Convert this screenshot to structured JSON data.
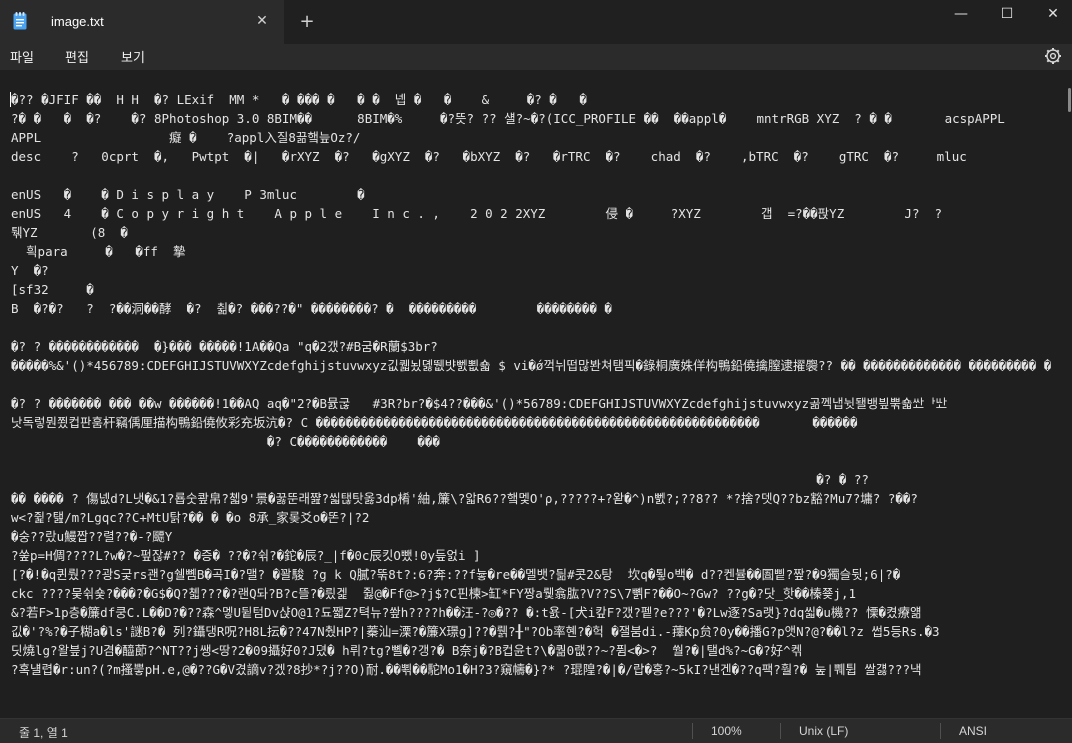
{
  "tab": {
    "title": "image.txt",
    "close_glyph": "✕",
    "new_tab_glyph": "+"
  },
  "window_controls": {
    "minimize": "—",
    "maximize": "☐",
    "close": "✕"
  },
  "menu": {
    "file": "파일",
    "edit": "편집",
    "view": "보기",
    "settings_icon": "gear-icon"
  },
  "editor": {
    "lines": [
      "�?? �JFIF ��  H H  �? LExif  MM *   � ��� �   � �  넵 �   �    &     �? �   �",
      "?� �   �  �?    �? 8Photoshop 3.0 8BIM��      8BIM�%     �?뜻? ?? 섈?~�?(ICC_PROFILE ��  ��appl�    mntrRGB XYZ  ? � �       acspAPPL",
      "APPL                 癡 �    ?appl入질8끎햌늪Oz?/",
      "desc    ?   0cprt  �,   Pwtpt  �|   �rXYZ  �?   �gXYZ  �?   �bXYZ  �?   �rTRC  �?    chad  �?    ,bTRC  �?    gTRC  �?     mluc",
      "",
      "enUS   �    � D i s p l a y    P 3mluc        �",
      "enUS   4    � C o p y r i g h t    A p p l e    I n c . ,    2 0 2 2XYZ        侵 �     ?XYZ        갭  =?��팑YZ        J?  ?",
      "퉦YZ       (8  �",
      "  흭para     �   �ff  摯",
      "Y  �?",
      "[sf32     �",
      "B  �?�?   ?  ?��洞��酵  �?  췲�? ���??�\" ��������? �  ���������        �������� �",
      "",
      "�? ? ������������  �}��� �����!1A��Qa \"q�2갰?#B굼�R蘭$3br?",
      "�����%&'()*456789:CDEFGHIJSTUVWXYZcdefghijstuvwxyz깂퀣뇠뎷뛦뱟뻸뾦숇 $ vi�ǿ꺽뉘떱많봔쳐탬픽�錄桐廣姝佯构鴨鉛僥擒膣逮擢褜?? �� ������������� ��������� �",
      "",
      "�? ? ������� ��� ��w ������!1��AQ aq�\"2?�B뮰굲   #3R?br?�$4??���&'()*56789:CDEFGHIJSTUVWXYZcdefghijstuvwxyz곪껙냅뉫됄뱅빂뿎숇ᄊᅶᅡᄔᅶ",
      "낫독렇뭔쬤컵판훔杆竊偊厘描构鴨鉛僥攸彩充坂沆�? C �����������������������������������������������������������       ������",
      "                                  �? C������������    ���",
      "",
      "                                                                                                           �? � ??",
      "�� ���� ? 傷넶d?L냇�&1?룝숫쾊帛?쳷9'景�꿇뚠래쨢?씳탢탓옳3dp㮁'紬,簾\\?앏R6??햌멫O'ρ,?????+?왇�^)n뻸?;??8?? *?捨?뎃Q??bz豁?Mu7?墉? ?��?",
      "w<?쥝?탪/m?Lgqc??C+MtU탉?�� � �o 8承_家롲爻o�똔?|?2",
      "�숭??랐u鰻짭??렬??�-?飃Y",
      "?쑾p=H倜????L?w�?~펖잖#?? �증� ??�?쉮?�鉈�辰?_|f�0c辰킷O뺐!0y듶엀i ]",
      "[?�!�q퀸뤘???광S긏rs괜?g쉘뼴B�곡I�?맬? �꽐駿 ?g k Q膩?뚞8t?:6?奔:??f늏�re��멜뱃?딂#콧2&탕  坎q�툏o백� d??켄뷸��圄삩?짶?�9獨슬뒷;6|?�",
      "ckc ????뭊쉮숓?���?�G$�Q?쳷???�?랜Q돠?B?c뜰?�릤겙  쥟@�Ff@>?j$?C핀楝>缸*FY짱a뤷翕肱?V??S\\7뼭F?��O~?Gw? ??g�?닷_핫��榛쭂j,1",
      "&?若F>1p층�簾df쿵C.L��D?�??森^멯U뒽텀Dv샩O@1?됴쨃Z?텩뉴?쐎h????h��汪-?◎�?? �:t욠-[犬i캎F?갰?펱?e???'�?Lw逐?Sa랫}?dq씳�u機?? 慄�켰療얢",
      "깂�'?%?�子糊a�ls'謎B?� 列?鑷댕R呪?H8L抎�??47N췄HP?|蓁汕=溧?�簾X璟g]??�뤩?╂\"?Ob率혠?�헉 �잴붐di.-蘀Kp贠?0y��播G?p앳N?@?��l?z 썹5등Rs.�3",
      "딧燒lg?왈븦j?U겸�醯莭?^NT??j쌩<땅?2�09攝好0?J뎠� h뤼?tg?뼬�?갱?� B奈j�?B컵윤t?\\�퀆0랪??~?퓜<�>?  쒈?�|탤d%?~G�?好^켂",
      "?혹냴렵�r:un?(?m搔쁳pH.e,@�??G�V겼謫v?겠?8抄*?j??O)耐.��뾖��駝Mo1�H?3?窺幬�}?* ?琨隍?�|�/랍�홍?~5kI?낸겐�??q팩?훨?� 눞|쀄튑 쌀걣???낵"
    ]
  },
  "status": {
    "position": "줄 1, 열 1",
    "zoom": "100%",
    "line_ending": "Unix (LF)",
    "encoding": "ANSI"
  }
}
